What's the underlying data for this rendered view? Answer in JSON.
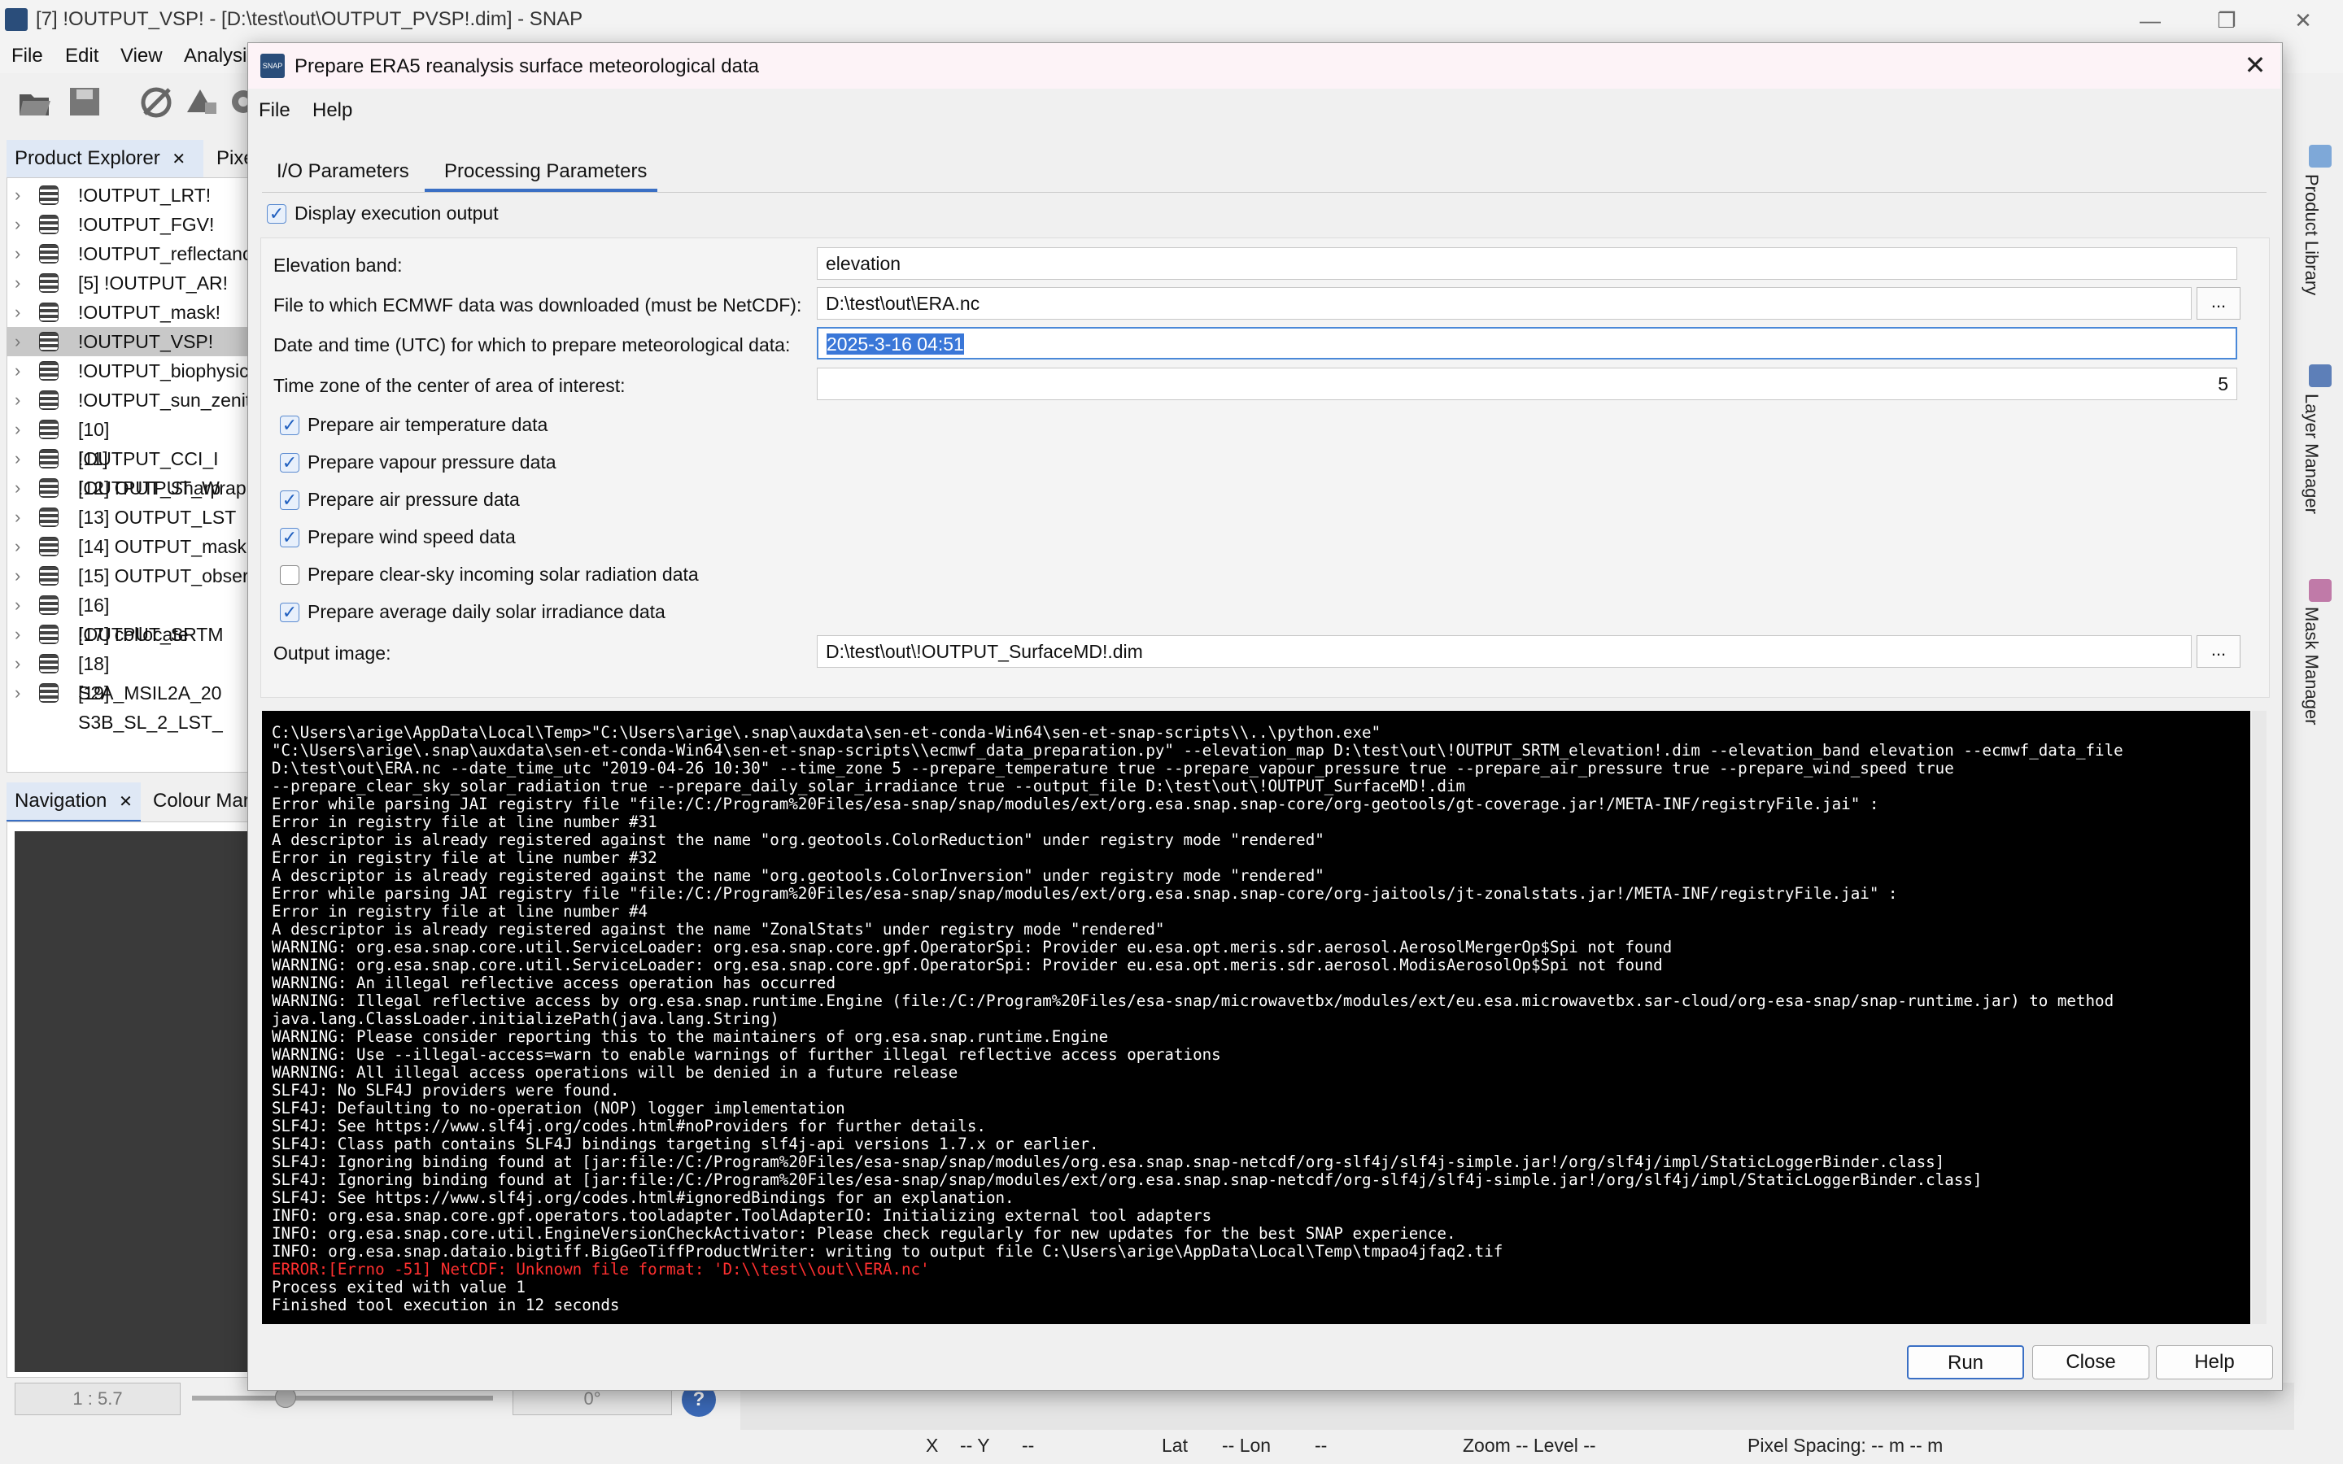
{
  "app": {
    "title": "[7] !OUTPUT_VSP! - [D:\\test\\out\\OUTPUT_PVSP!.dim] - SNAP",
    "minimize": "—",
    "restore": "❐",
    "close": "✕",
    "menu": [
      "File",
      "Edit",
      "View",
      "Analysi"
    ]
  },
  "left_panel": {
    "tabs": [
      "Product Explorer",
      "Pixe"
    ],
    "tab_close": "✕",
    "products": [
      "!OUTPUT_LRT!",
      "!OUTPUT_FGV!",
      "!OUTPUT_reflectanc",
      "[5] !OUTPUT_AR!",
      "!OUTPUT_mask!",
      "!OUTPUT_VSP!",
      "!OUTPUT_biophysic",
      "!OUTPUT_sun_zenit",
      "[10] !OUTPUT_CCI_I",
      "[11] !OUTPUT_Sharp",
      "[12] OUTPUT_Wrap",
      "[13] OUTPUT_LST",
      "[14] OUTPUT_mask",
      "[15] OUTPUT_obser",
      "[16] !OUTPUT_SRTM",
      "[17] collocate",
      "[18] S2A_MSIL2A_20",
      "[19] S3B_SL_2_LST_"
    ],
    "selected_index": 5,
    "chevron": "›"
  },
  "nav_panel": {
    "tabs": [
      "Navigation",
      "Colour Mar"
    ],
    "tab_close": "✕",
    "scale": "1 : 5.7",
    "angle": "0°",
    "help": "?"
  },
  "right_strip": {
    "tabs": [
      "Product Library",
      "Layer Manager",
      "Mask Manager"
    ]
  },
  "status_bar": {
    "x": "X",
    "x_val": "-- Y",
    "y_val": "--",
    "lat": "Lat",
    "lat_val": "-- Lon",
    "lon_val": "--",
    "zoom": "Zoom --  Level --",
    "pixel_spacing": "Pixel Spacing: -- m -- m"
  },
  "dialog": {
    "icon_text": "SNAP",
    "title": "Prepare ERA5 reanalysis surface meteorological data",
    "close": "✕",
    "menu": [
      "File",
      "Help"
    ],
    "tabs": [
      "I/O Parameters",
      "Processing Parameters"
    ],
    "active_tab": 1,
    "display_output_label": "Display execution output",
    "display_output_checked": true,
    "fields": {
      "elevation_band": {
        "label": "Elevation band:",
        "value": "elevation"
      },
      "ecmwf_file": {
        "label": "File to which ECMWF data was downloaded (must be NetCDF):",
        "value": "D:\\test\\out\\ERA.nc",
        "browse": "..."
      },
      "date_time": {
        "label": "Date and time (UTC) for which to prepare meteorological data:",
        "value": "2025-3-16 04:51"
      },
      "time_zone": {
        "label": "Time zone of the center of area of interest:",
        "value": "5"
      },
      "output_image": {
        "label": "Output image:",
        "value": "D:\\test\\out\\!OUTPUT_SurfaceMD!.dim",
        "browse": "..."
      }
    },
    "options": [
      {
        "label": "Prepare air temperature data",
        "checked": true
      },
      {
        "label": "Prepare vapour pressure data",
        "checked": true
      },
      {
        "label": "Prepare air pressure data",
        "checked": true
      },
      {
        "label": "Prepare wind speed data",
        "checked": true
      },
      {
        "label": "Prepare clear-sky incoming solar radiation data",
        "checked": false
      },
      {
        "label": "Prepare average daily solar irradiance data",
        "checked": true
      }
    ],
    "console": [
      {
        "text": "C:\\Users\\arige\\AppData\\Local\\Temp>\"C:\\Users\\arige\\.snap\\auxdata\\sen-et-conda-Win64\\sen-et-snap-scripts\\\\..\\python.exe\"",
        "error": false
      },
      {
        "text": "\"C:\\Users\\arige\\.snap\\auxdata\\sen-et-conda-Win64\\sen-et-snap-scripts\\\\ecmwf_data_preparation.py\" --elevation_map D:\\test\\out\\!OUTPUT_SRTM_elevation!.dim --elevation_band elevation --ecmwf_data_file",
        "error": false
      },
      {
        "text": "D:\\test\\out\\ERA.nc --date_time_utc \"2019-04-26 10:30\" --time_zone 5 --prepare_temperature true --prepare_vapour_pressure true --prepare_air_pressure true --prepare_wind_speed true",
        "error": false
      },
      {
        "text": "--prepare_clear_sky_solar_radiation true --prepare_daily_solar_irradiance true --output_file D:\\test\\out\\!OUTPUT_SurfaceMD!.dim",
        "error": false
      },
      {
        "text": "Error while parsing JAI registry file \"file:/C:/Program%20Files/esa-snap/snap/modules/ext/org.esa.snap.snap-core/org-geotools/gt-coverage.jar!/META-INF/registryFile.jai\" :",
        "error": false
      },
      {
        "text": "Error in registry file at line number #31",
        "error": false
      },
      {
        "text": "A descriptor is already registered against the name \"org.geotools.ColorReduction\" under registry mode \"rendered\"",
        "error": false
      },
      {
        "text": "Error in registry file at line number #32",
        "error": false
      },
      {
        "text": "A descriptor is already registered against the name \"org.geotools.ColorInversion\" under registry mode \"rendered\"",
        "error": false
      },
      {
        "text": "Error while parsing JAI registry file \"file:/C:/Program%20Files/esa-snap/snap/modules/ext/org.esa.snap.snap-core/org-jaitools/jt-zonalstats.jar!/META-INF/registryFile.jai\" :",
        "error": false
      },
      {
        "text": "Error in registry file at line number #4",
        "error": false
      },
      {
        "text": "A descriptor is already registered against the name \"ZonalStats\" under registry mode \"rendered\"",
        "error": false
      },
      {
        "text": "WARNING: org.esa.snap.core.util.ServiceLoader: org.esa.snap.core.gpf.OperatorSpi: Provider eu.esa.opt.meris.sdr.aerosol.AerosolMergerOp$Spi not found",
        "error": false
      },
      {
        "text": "WARNING: org.esa.snap.core.util.ServiceLoader: org.esa.snap.core.gpf.OperatorSpi: Provider eu.esa.opt.meris.sdr.aerosol.ModisAerosolOp$Spi not found",
        "error": false
      },
      {
        "text": "WARNING: An illegal reflective access operation has occurred",
        "error": false
      },
      {
        "text": "WARNING: Illegal reflective access by org.esa.snap.runtime.Engine (file:/C:/Program%20Files/esa-snap/microwavetbx/modules/ext/eu.esa.microwavetbx.sar-cloud/org-esa-snap/snap-runtime.jar) to method",
        "error": false
      },
      {
        "text": "java.lang.ClassLoader.initializePath(java.lang.String)",
        "error": false
      },
      {
        "text": "WARNING: Please consider reporting this to the maintainers of org.esa.snap.runtime.Engine",
        "error": false
      },
      {
        "text": "WARNING: Use --illegal-access=warn to enable warnings of further illegal reflective access operations",
        "error": false
      },
      {
        "text": "WARNING: All illegal access operations will be denied in a future release",
        "error": false
      },
      {
        "text": "SLF4J: No SLF4J providers were found.",
        "error": false
      },
      {
        "text": "SLF4J: Defaulting to no-operation (NOP) logger implementation",
        "error": false
      },
      {
        "text": "SLF4J: See https://www.slf4j.org/codes.html#noProviders for further details.",
        "error": false
      },
      {
        "text": "SLF4J: Class path contains SLF4J bindings targeting slf4j-api versions 1.7.x or earlier.",
        "error": false
      },
      {
        "text": "SLF4J: Ignoring binding found at [jar:file:/C:/Program%20Files/esa-snap/snap/modules/org.esa.snap.snap-netcdf/org-slf4j/slf4j-simple.jar!/org/slf4j/impl/StaticLoggerBinder.class]",
        "error": false
      },
      {
        "text": "SLF4J: Ignoring binding found at [jar:file:/C:/Program%20Files/esa-snap/snap/modules/ext/org.esa.snap.snap-netcdf/org-slf4j/slf4j-simple.jar!/org/slf4j/impl/StaticLoggerBinder.class]",
        "error": false
      },
      {
        "text": "SLF4J: See https://www.slf4j.org/codes.html#ignoredBindings for an explanation.",
        "error": false
      },
      {
        "text": "INFO: org.esa.snap.core.gpf.operators.tooladapter.ToolAdapterIO: Initializing external tool adapters",
        "error": false
      },
      {
        "text": "INFO: org.esa.snap.core.util.EngineVersionCheckActivator: Please check regularly for new updates for the best SNAP experience.",
        "error": false
      },
      {
        "text": "INFO: org.esa.snap.dataio.bigtiff.BigGeoTiffProductWriter: writing to output file C:\\Users\\arige\\AppData\\Local\\Temp\\tmpao4jfaq2.tif",
        "error": false
      },
      {
        "text": "ERROR:[Errno -51] NetCDF: Unknown file format: 'D:\\\\test\\\\out\\\\ERA.nc'",
        "error": true
      },
      {
        "text": "Process exited with value 1",
        "error": false
      },
      {
        "text": "Finished tool execution in 12 seconds",
        "error": false
      }
    ],
    "buttons": {
      "run": "Run",
      "close": "Close",
      "help": "Help"
    }
  }
}
